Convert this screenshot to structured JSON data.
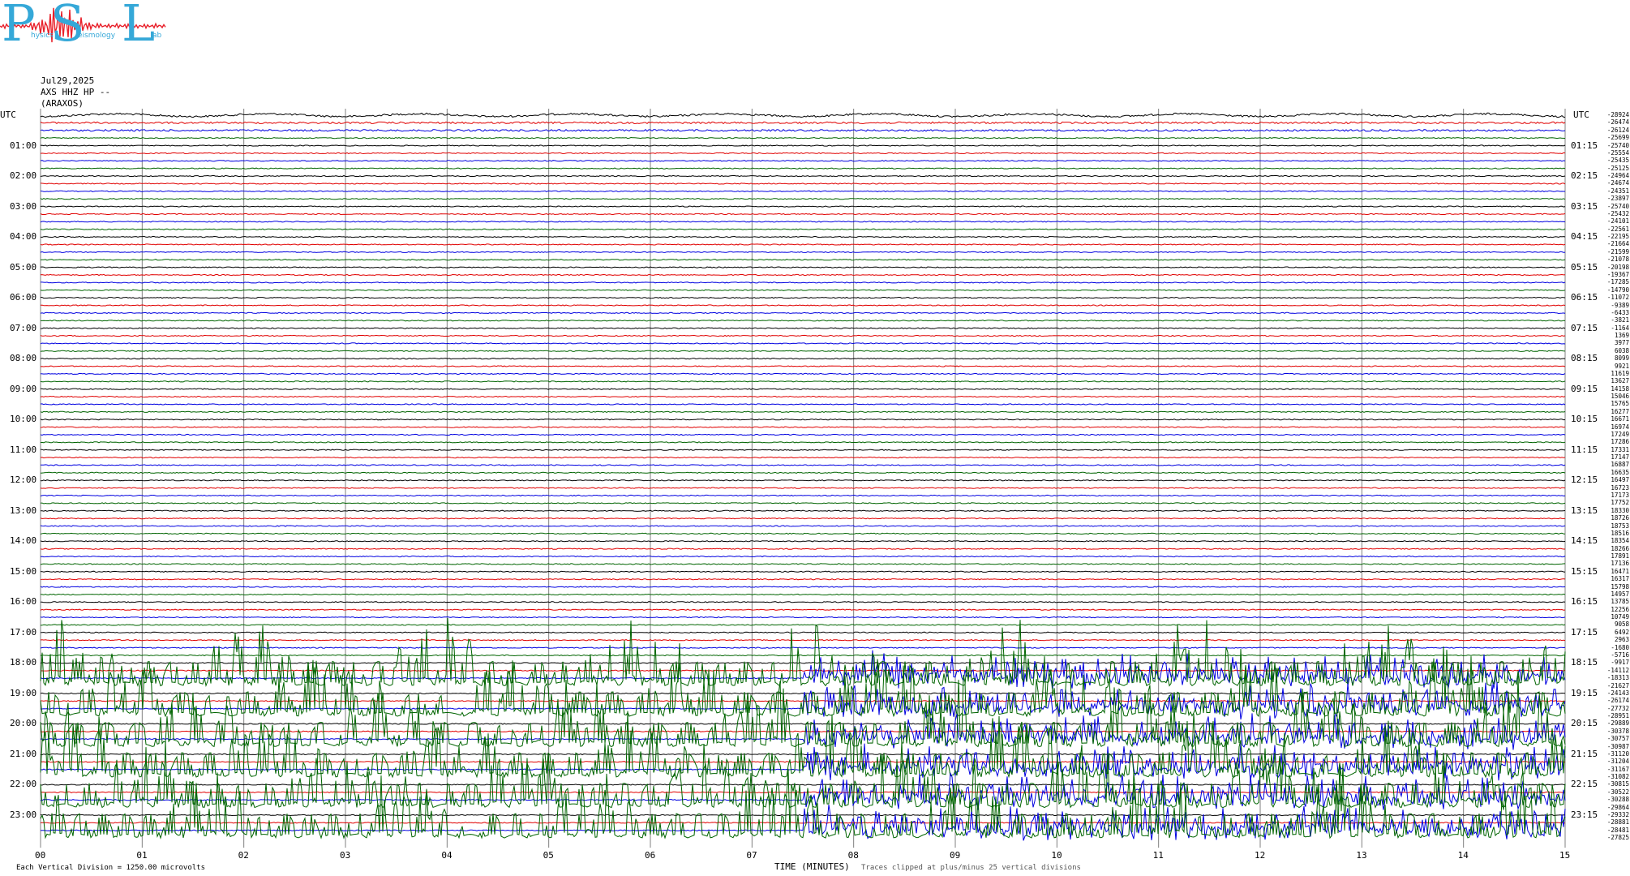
{
  "logo": {
    "letters": [
      "P",
      "S",
      "L"
    ],
    "words": [
      "hysics",
      "eismology",
      "ab"
    ],
    "wave_color": "#e8202a",
    "text_color": "#35a8d8"
  },
  "header": {
    "date": "Jul29,2025",
    "channel": "AXS HHZ HP --",
    "station": "(ARAXOS)"
  },
  "chart_data": {
    "type": "line",
    "title": "Jul29,2025",
    "subtitle": "AXS HHZ HP -- (ARAXOS)",
    "xlabel": "TIME (MINUTES)",
    "x_ticks": [
      "00",
      "01",
      "02",
      "03",
      "04",
      "05",
      "06",
      "07",
      "08",
      "09",
      "10",
      "11",
      "12",
      "13",
      "14",
      "15"
    ],
    "xlim": [
      0,
      15
    ],
    "left_axis_label": "UTC",
    "right_axis_label": "UTC",
    "left_hours": [
      "01:00",
      "02:00",
      "03:00",
      "04:00",
      "05:00",
      "06:00",
      "07:00",
      "08:00",
      "09:00",
      "10:00",
      "11:00",
      "12:00",
      "13:00",
      "14:00",
      "15:00",
      "16:00",
      "17:00",
      "18:00",
      "19:00",
      "20:00",
      "21:00",
      "22:00",
      "23:00"
    ],
    "right_hours": [
      "01:15",
      "02:15",
      "03:15",
      "04:15",
      "05:15",
      "06:15",
      "07:15",
      "08:15",
      "09:15",
      "10:15",
      "11:15",
      "12:15",
      "13:15",
      "14:15",
      "15:15",
      "16:15",
      "17:15",
      "18:15",
      "19:15",
      "20:15",
      "21:15",
      "22:15",
      "23:15"
    ],
    "trace_colors": [
      "#000000",
      "#e00000",
      "#0000e0",
      "#006400"
    ],
    "trace_offsets": [
      "-28924",
      "-26474",
      "-26124",
      "-25699",
      "-25740",
      "-25554",
      "-25435",
      "-25125",
      "-24964",
      "-24674",
      "-24351",
      "-23897",
      "-25740",
      "-25432",
      "-24101",
      "-22561",
      "-22195",
      "-21664",
      "-21599",
      "-21078",
      "-20198",
      "-19367",
      "-17285",
      "-14790",
      "-11072",
      "-9389",
      "-6433",
      "-3821",
      "-1164",
      "1369",
      "3977",
      "6038",
      "8099",
      "9921",
      "11619",
      "13627",
      "14158",
      "15046",
      "15765",
      "16277",
      "16671",
      "16974",
      "17249",
      "17286",
      "17331",
      "17147",
      "16887",
      "16635",
      "16497",
      "16723",
      "17173",
      "17752",
      "18330",
      "18726",
      "18753",
      "18516",
      "18354",
      "18266",
      "17891",
      "17136",
      "16471",
      "16317",
      "15798",
      "14957",
      "13785",
      "12256",
      "10749",
      "9058",
      "6492",
      "2963",
      "-1680",
      "-5716",
      "-9917",
      "-14112",
      "-18313",
      "-21627",
      "-24143",
      "-26174",
      "-27732",
      "-28951",
      "-29889",
      "-30378",
      "-30757",
      "-30987",
      "-31120",
      "-31204",
      "-31167",
      "-31082",
      "-30815",
      "-30522",
      "-30288",
      "-29864",
      "-29332",
      "-28881",
      "-28481",
      "-27825"
    ],
    "footer_left": "Each Vertical Division = 1250.00 microvolts",
    "footer_right": "Traces clipped at plus/minus 25 vertical divisions"
  }
}
